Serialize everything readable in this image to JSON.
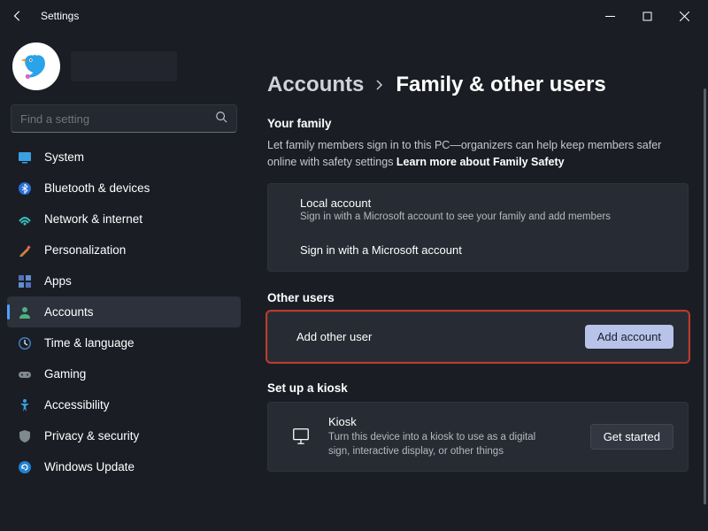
{
  "titlebar": {
    "title": "Settings"
  },
  "search": {
    "placeholder": "Find a setting"
  },
  "nav": {
    "items": [
      {
        "label": "System",
        "icon": "system"
      },
      {
        "label": "Bluetooth & devices",
        "icon": "bluetooth"
      },
      {
        "label": "Network & internet",
        "icon": "network"
      },
      {
        "label": "Personalization",
        "icon": "personalization"
      },
      {
        "label": "Apps",
        "icon": "apps"
      },
      {
        "label": "Accounts",
        "icon": "accounts"
      },
      {
        "label": "Time & language",
        "icon": "time"
      },
      {
        "label": "Gaming",
        "icon": "gaming"
      },
      {
        "label": "Accessibility",
        "icon": "accessibility"
      },
      {
        "label": "Privacy & security",
        "icon": "privacy"
      },
      {
        "label": "Windows Update",
        "icon": "update"
      }
    ],
    "active_index": 5
  },
  "breadcrumb": {
    "root": "Accounts",
    "leaf": "Family & other users"
  },
  "family": {
    "heading": "Your family",
    "desc_prefix": "Let family members sign in to this PC—organizers can help keep members safer online with safety settings  ",
    "link": "Learn more about Family Safety",
    "card_title": "Local account",
    "card_sub": "Sign in with a Microsoft account to see your family and add members",
    "card_action": "Sign in with a Microsoft account"
  },
  "other": {
    "heading": "Other users",
    "row_label": "Add other user",
    "row_button": "Add account"
  },
  "kiosk": {
    "heading": "Set up a kiosk",
    "title": "Kiosk",
    "sub": "Turn this device into a kiosk to use as a digital sign, interactive display, or other things",
    "button": "Get started"
  }
}
